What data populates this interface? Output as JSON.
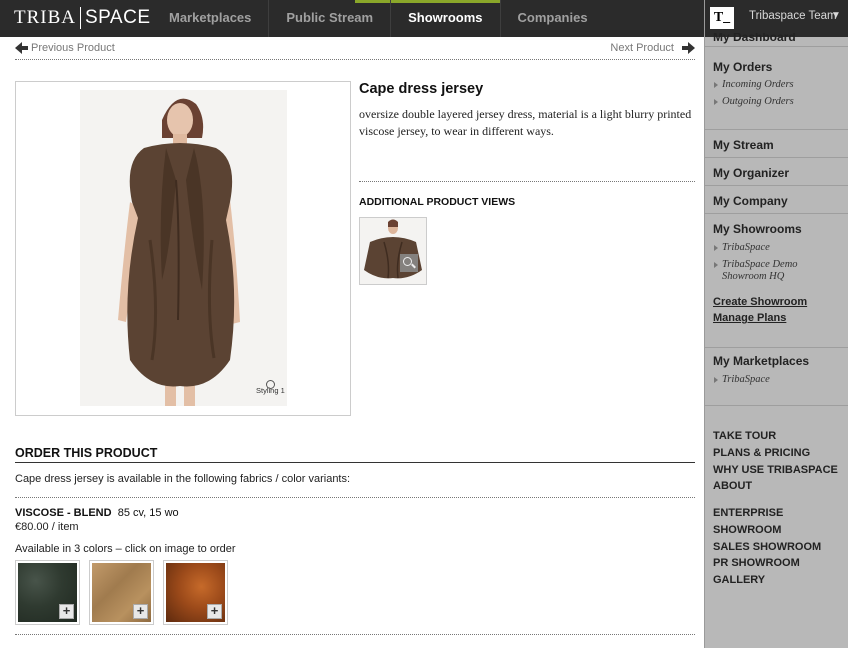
{
  "brand": {
    "part1": "TRIBA",
    "part2": "SPACE"
  },
  "nav": [
    {
      "label": "Marketplaces",
      "active": false
    },
    {
      "label": "Public Stream",
      "active": false
    },
    {
      "label": "Showrooms",
      "active": true
    },
    {
      "label": "Companies",
      "active": false
    }
  ],
  "account": {
    "badge": "T_",
    "team": "Tribaspace Team"
  },
  "pager": {
    "prev": "Previous Product",
    "next": "Next Product"
  },
  "product": {
    "title": "Cape dress jersey",
    "description": "oversize double layered jersey dress, material is a light blurry printed viscose jersey, to wear in different ways.",
    "image_caption": "Styling 1",
    "additional_views_title": "ADDITIONAL PRODUCT VIEWS"
  },
  "order": {
    "heading": "ORDER THIS PRODUCT",
    "intro": "Cape dress jersey is available in the following fabrics / color variants:",
    "fabric_name": "VISCOSE - BLEND",
    "fabric_comp": "85 cv, 15 wo",
    "price": "€80.00 / item",
    "colors_note": "Available in 3 colors – click on image to order",
    "swatches": [
      {
        "name": "dark-green",
        "color": "#2f3a30"
      },
      {
        "name": "sand",
        "color": "#b08a5c"
      },
      {
        "name": "rust",
        "color": "#9c4a1a"
      }
    ]
  },
  "sidebar": {
    "my_dashboard": "My Dashboard",
    "my_orders": "My Orders",
    "incoming_orders": "Incoming Orders",
    "outgoing_orders": "Outgoing Orders",
    "my_stream": "My Stream",
    "my_organizer": "My Organizer",
    "my_company": "My Company",
    "my_showrooms": "My Showrooms",
    "showroom_1": "TribaSpace",
    "showroom_2": "TribaSpace Demo Showroom HQ",
    "create_showroom": "Create Showroom",
    "manage_plans": "Manage Plans",
    "my_marketplaces": "My Marketplaces",
    "marketplace_1": "TribaSpace",
    "take_tour": "TAKE TOUR",
    "plans_pricing": "PLANS & PRICING",
    "why_use": "WHY USE TRIBASPACE",
    "about": "ABOUT",
    "enterprise": "ENTERPRISE",
    "showroom": "SHOWROOM",
    "sales_showroom": "SALES SHOWROOM",
    "pr_showroom": "PR SHOWROOM",
    "gallery": "GALLERY"
  },
  "colors": {
    "topbar": "#2b2b2b",
    "sidebar": "#b8b8b8",
    "dress": "#5b4333"
  }
}
